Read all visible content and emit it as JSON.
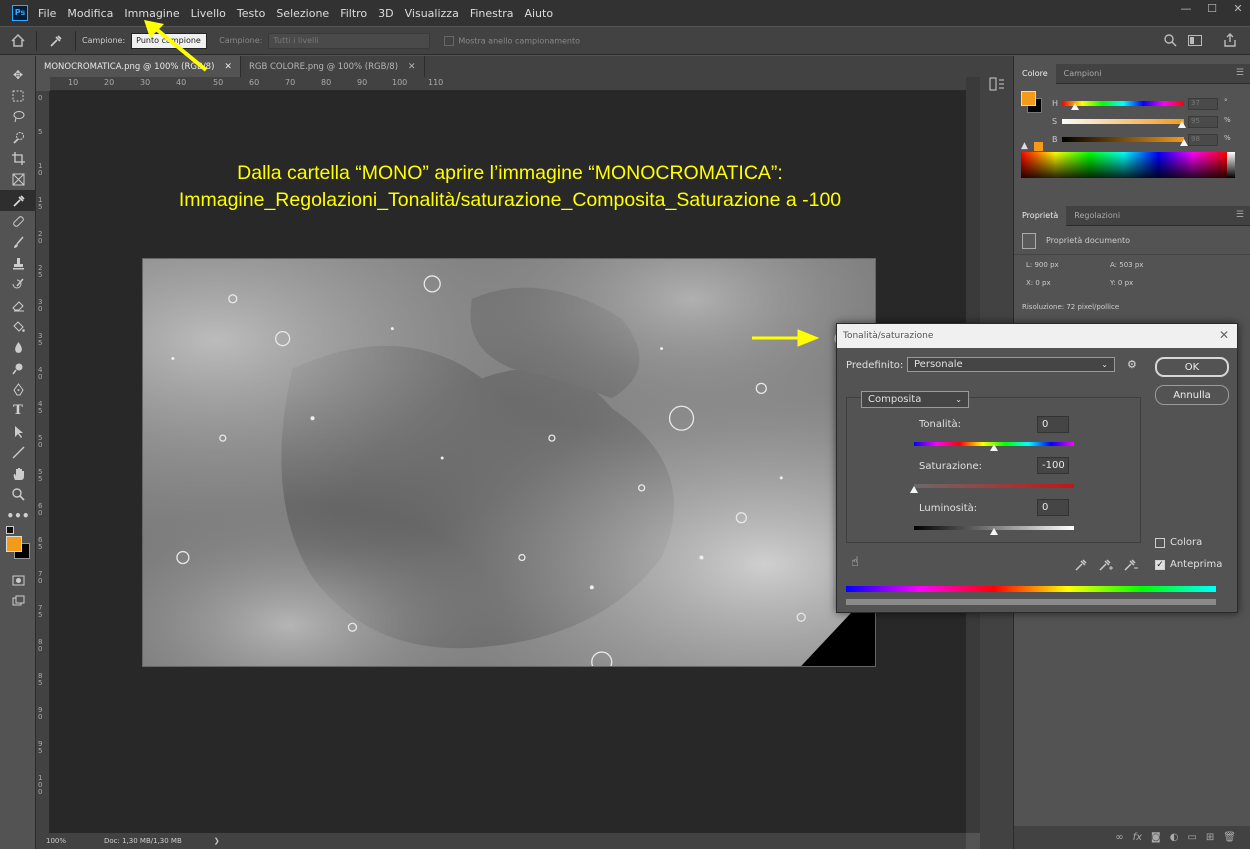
{
  "app": {
    "logo": "Ps"
  },
  "menu": [
    "File",
    "Modifica",
    "Immagine",
    "Livello",
    "Testo",
    "Selezione",
    "Filtro",
    "3D",
    "Visualizza",
    "Finestra",
    "Aiuto"
  ],
  "window_controls": {
    "minimize": "—",
    "maximize": "☐",
    "close": "✕"
  },
  "options_bar": {
    "sample_label": "Campione:",
    "sample_value": "Punto campione",
    "sample2_label": "Campione:",
    "sample2_value": "Tutti i livelli",
    "ring_label": "Mostra anello campionamento"
  },
  "tabs": [
    {
      "label": "MONOCROMATICA.png @ 100% (RGB/8)",
      "close": "✕"
    },
    {
      "label": "RGB COLORE.png @ 100% (RGB/8)",
      "close": "✕"
    }
  ],
  "ruler_h_labels": [
    "10",
    "20",
    "30",
    "40",
    "50",
    "60",
    "70",
    "80",
    "90",
    "100",
    "110"
  ],
  "ruler_v_labels": [
    "0",
    "5",
    "10",
    "15",
    "20",
    "25",
    "30",
    "35",
    "40",
    "45",
    "50",
    "55",
    "60",
    "65",
    "70",
    "75",
    "80",
    "85",
    "90",
    "95",
    "100"
  ],
  "instructions": {
    "line1": "Dalla cartella “MONO” aprire l’immagine “MONOCROMATICA”:",
    "line2": "Immagine_Regolazioni_Tonalità/saturazione_Composita_Saturazione a -100"
  },
  "status": {
    "zoom": "100%",
    "doc": "Doc: 1,30 MB/1,30 MB",
    "arrow": "❯"
  },
  "color_panel": {
    "tabs": [
      "Colore",
      "Campioni"
    ],
    "h_label": "H",
    "s_label": "S",
    "b_label": "B",
    "h_value": "37",
    "s_value": "95",
    "b_value": "98",
    "h_unit": "°",
    "s_unit": "%",
    "b_unit": "%",
    "foreground": "#f39a1a",
    "background": "#000000"
  },
  "props_panel": {
    "tabs": [
      "Proprietà",
      "Regolazioni"
    ],
    "doc_label": "Proprietà documento",
    "l": "L: 900 px",
    "a": "A: 503 px",
    "x": "X: 0 px",
    "y": "Y: 0 px",
    "resolution": "Risoluzione: 72 pixel/pollice"
  },
  "dialog": {
    "title": "Tonalità/saturazione",
    "close": "✕",
    "preset_label": "Predefinito:",
    "preset_value": "Personale",
    "ok": "OK",
    "cancel": "Annulla",
    "channel": "Composita",
    "hue_label": "Tonalità:",
    "hue_value": "0",
    "sat_label": "Saturazione:",
    "sat_value": "-100",
    "light_label": "Luminosità:",
    "light_value": "0",
    "colorize_label": "Colora",
    "preview_label": "Anteprima",
    "hue": 0,
    "saturation": -100,
    "lightness": 0
  },
  "colors": {
    "accent_yellow": "#ffff00"
  }
}
